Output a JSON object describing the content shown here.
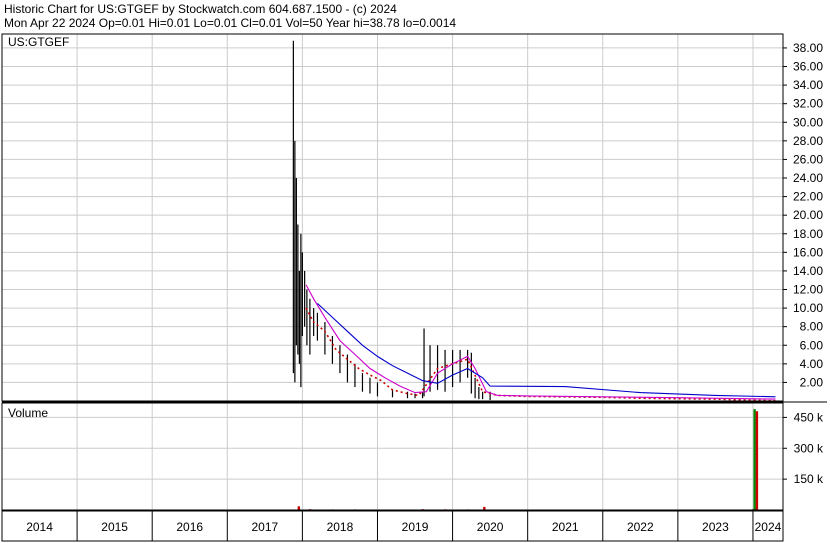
{
  "header": {
    "line1": "Historic Chart for US:GTGEF by Stockwatch.com 604.687.1500 - (c) 2024",
    "line2": "Mon Apr 22 2024  Op=0.01  Hi=0.01  Lo=0.01  Cl=0.01  Vol=50  Year hi=38.78  lo=0.0014"
  },
  "chart_data": [
    {
      "type": "line",
      "title": "US:GTGEF",
      "ylim": [
        0,
        39.5
      ],
      "yticks": [
        "38.00",
        "36.00",
        "34.00",
        "32.00",
        "30.00",
        "28.00",
        "26.00",
        "24.00",
        "22.00",
        "20.00",
        "18.00",
        "16.00",
        "14.00",
        "12.00",
        "10.00",
        "8.00",
        "6.00",
        "4.00",
        "2.00"
      ],
      "grid": true,
      "series": [
        {
          "kind": "price-range",
          "color": "#000000",
          "x": [
            2017.88,
            2017.9,
            2017.92,
            2017.94,
            2017.96,
            2017.98,
            2018.0,
            2018.03,
            2018.06,
            2018.1,
            2018.15,
            2018.2,
            2018.3,
            2018.4,
            2018.5,
            2018.6,
            2018.7,
            2018.8,
            2018.9,
            2019.0,
            2019.2,
            2019.4,
            2019.5,
            2019.6,
            2019.62,
            2019.7,
            2019.8,
            2019.9,
            2020.0,
            2020.1,
            2020.2,
            2020.25,
            2020.3,
            2020.35,
            2020.4,
            2020.5
          ],
          "high": [
            38.78,
            28.0,
            24.0,
            19.0,
            14.0,
            18.0,
            16.0,
            14.0,
            12.0,
            11.0,
            10.0,
            9.5,
            8.5,
            7.0,
            6.0,
            5.0,
            4.0,
            3.0,
            2.5,
            2.0,
            1.2,
            1.0,
            0.8,
            1.0,
            7.8,
            6.0,
            6.0,
            5.5,
            5.5,
            5.5,
            5.5,
            5.2,
            2.5,
            1.5,
            1.0,
            1.0
          ],
          "low": [
            3.0,
            2.0,
            6.0,
            5.0,
            4.0,
            1.5,
            7.0,
            8.0,
            6.0,
            5.0,
            7.0,
            6.5,
            5.0,
            4.0,
            3.0,
            2.0,
            1.5,
            1.0,
            0.8,
            0.5,
            0.4,
            0.3,
            0.3,
            0.3,
            0.5,
            1.0,
            1.2,
            1.0,
            1.5,
            2.0,
            2.5,
            0.8,
            0.3,
            0.2,
            0.2,
            0.1
          ]
        },
        {
          "kind": "close",
          "color": "#cc0000",
          "x": [
            2018.05,
            2018.15,
            2018.3,
            2018.45,
            2018.6,
            2018.75,
            2018.9,
            2019.05,
            2019.2,
            2019.4,
            2019.55,
            2019.8,
            2020.0,
            2020.2,
            2020.4,
            2020.6,
            2021.0,
            2022.0,
            2022.5,
            2023.0,
            2023.5,
            2024.3
          ],
          "values": [
            10.0,
            8.5,
            7.5,
            5.5,
            4.5,
            3.5,
            2.8,
            2.2,
            1.2,
            0.8,
            0.6,
            3.5,
            4.0,
            4.5,
            1.0,
            0.6,
            0.5,
            0.4,
            0.3,
            0.25,
            0.2,
            0.01
          ]
        },
        {
          "kind": "moving-average-short",
          "color": "#cc00cc",
          "x": [
            2018.05,
            2018.15,
            2018.3,
            2018.5,
            2018.7,
            2018.9,
            2019.1,
            2019.3,
            2019.5,
            2019.65,
            2019.8,
            2020.0,
            2020.2,
            2020.3,
            2020.45,
            2020.6,
            2021.0,
            2022.0,
            2023.0,
            2024.3
          ],
          "values": [
            12.5,
            11.0,
            9.0,
            6.5,
            5.0,
            3.5,
            2.5,
            1.6,
            0.9,
            1.0,
            3.0,
            4.0,
            4.8,
            3.5,
            1.0,
            0.6,
            0.55,
            0.45,
            0.35,
            0.2
          ]
        },
        {
          "kind": "moving-average-long",
          "color": "#0000cc",
          "x": [
            2018.2,
            2018.4,
            2018.6,
            2018.8,
            2019.0,
            2019.2,
            2019.4,
            2019.6,
            2019.8,
            2020.0,
            2020.2,
            2020.4,
            2020.5,
            2021.5,
            2022.5,
            2023.5,
            2024.3
          ],
          "values": [
            10.5,
            9.0,
            7.5,
            6.0,
            4.8,
            3.8,
            3.0,
            2.2,
            1.9,
            2.8,
            3.5,
            2.5,
            1.6,
            1.55,
            0.9,
            0.6,
            0.45
          ]
        }
      ]
    },
    {
      "type": "bar",
      "title": "Volume",
      "ylim": [
        0,
        520000
      ],
      "yticks": [
        "450 k",
        "300 k",
        "150 k"
      ],
      "x": [
        2017.95,
        2018.1,
        2018.4,
        2018.7,
        2019.0,
        2019.3,
        2019.6,
        2019.9,
        2020.2,
        2020.42,
        2021.5,
        2022.5,
        2023.0,
        2023.5,
        2024.0,
        2024.02,
        2024.05
      ],
      "values": [
        18000,
        4000,
        3000,
        3000,
        2500,
        2500,
        4000,
        3500,
        3000,
        15000,
        1500,
        2000,
        1500,
        2000,
        4000,
        490000,
        480000
      ],
      "colors": [
        "#cc0000",
        "#cc0000",
        "#cc0000",
        "#cc0000",
        "#cc0000",
        "#cc0000",
        "#cc0000",
        "#cc0000",
        "#cc0000",
        "#cc0000",
        "#cc0000",
        "#cc0000",
        "#cc0000",
        "#cc0000",
        "#cc0000",
        "#008800",
        "#cc0000"
      ]
    }
  ],
  "x_axis": {
    "years": [
      "2014",
      "2015",
      "2016",
      "2017",
      "2018",
      "2019",
      "2020",
      "2021",
      "2022",
      "2023",
      "2024"
    ]
  }
}
